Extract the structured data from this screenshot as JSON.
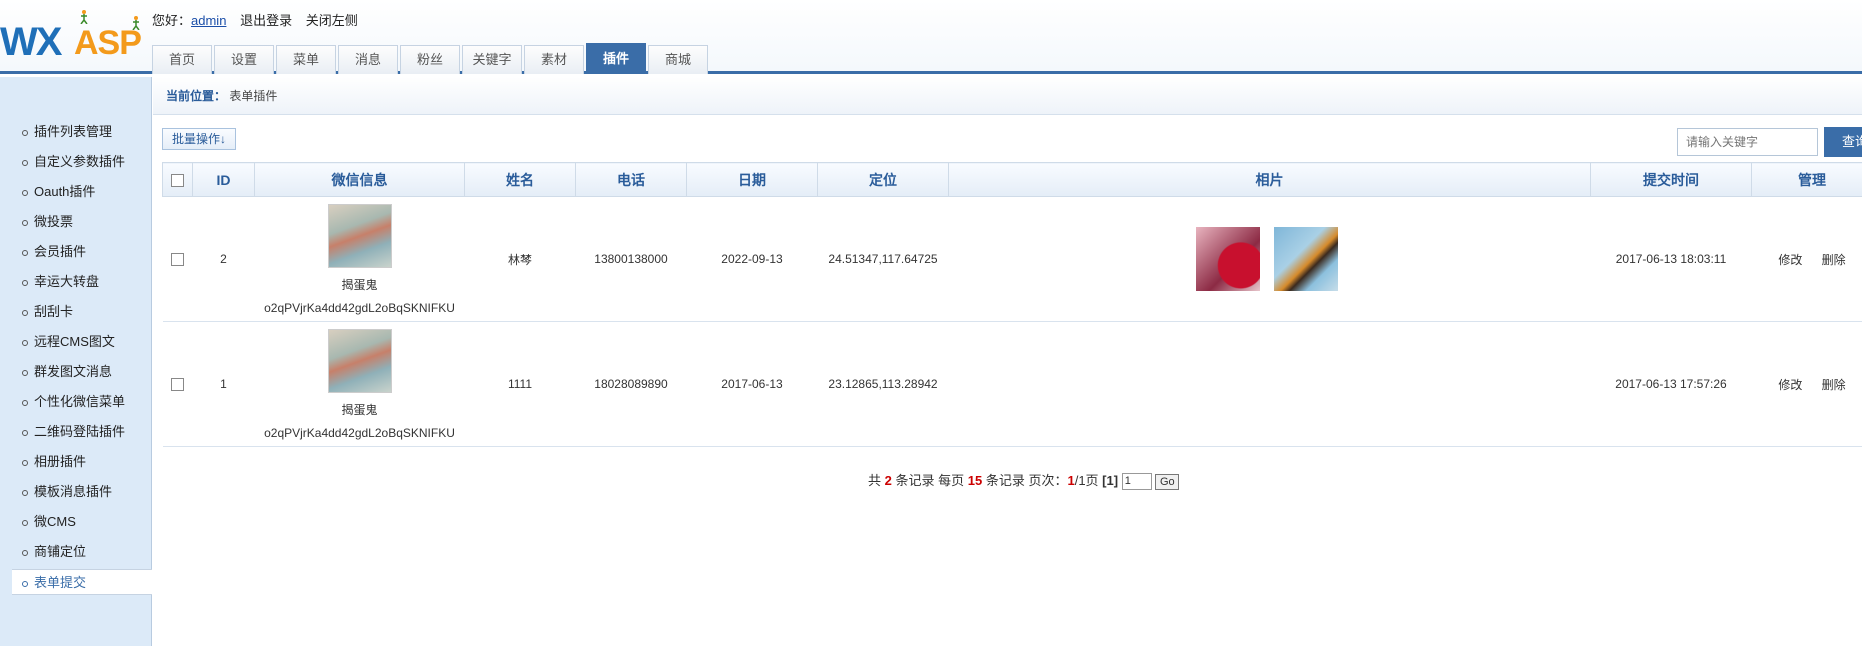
{
  "logo": {
    "text_left": "WX",
    "text_right": "ASP"
  },
  "userbar": {
    "greeting": "您好：",
    "username": "admin",
    "logout": "退出登录",
    "close_left": "关闭左侧"
  },
  "tabs": [
    {
      "label": "首页"
    },
    {
      "label": "设置"
    },
    {
      "label": "菜单"
    },
    {
      "label": "消息"
    },
    {
      "label": "粉丝"
    },
    {
      "label": "关键字"
    },
    {
      "label": "素材"
    },
    {
      "label": "插件",
      "active": true
    },
    {
      "label": "商城"
    }
  ],
  "sidebar": {
    "items": [
      {
        "label": "插件列表管理"
      },
      {
        "label": "自定义参数插件"
      },
      {
        "label": "Oauth插件"
      },
      {
        "label": "微投票"
      },
      {
        "label": "会员插件"
      },
      {
        "label": "幸运大转盘"
      },
      {
        "label": "刮刮卡"
      },
      {
        "label": "远程CMS图文"
      },
      {
        "label": "群发图文消息"
      },
      {
        "label": "个性化微信菜单"
      },
      {
        "label": "二维码登陆插件"
      },
      {
        "label": "相册插件"
      },
      {
        "label": "模板消息插件"
      },
      {
        "label": "微CMS"
      },
      {
        "label": "商铺定位"
      },
      {
        "label": "表单提交",
        "active": true
      }
    ]
  },
  "breadcrumb": {
    "label": "当前位置：",
    "current": "表单插件"
  },
  "toolbar": {
    "batch_label": "批量操作↓",
    "search_placeholder": "请输入关键字",
    "search_label": "查询"
  },
  "table": {
    "headers": [
      "ID",
      "微信信息",
      "姓名",
      "电话",
      "日期",
      "定位",
      "相片",
      "提交时间",
      "管理"
    ],
    "rows": [
      {
        "id": "2",
        "wx_name": "揭蛋鬼",
        "wx_id": "o2qPVjrKa4dd42gdL2oBqSKNIFKU",
        "name": "林棽",
        "phone": "13800138000",
        "date": "2022-09-13",
        "location": "24.51347,117.64725",
        "photos": 2,
        "submit_time": "2017-06-13 18:03:11",
        "edit": "修改",
        "delete": "删除"
      },
      {
        "id": "1",
        "wx_name": "揭蛋鬼",
        "wx_id": "o2qPVjrKa4dd42gdL2oBqSKNIFKU",
        "name": "1111",
        "phone": "18028089890",
        "date": "2017-06-13",
        "location": "23.12865,113.28942",
        "photos": 0,
        "submit_time": "2017-06-13 17:57:26",
        "edit": "修改",
        "delete": "删除"
      }
    ]
  },
  "pager": {
    "total_prefix": "共",
    "total": "2",
    "total_suffix": "条记录 每页",
    "per_page": "15",
    "per_page_suffix": "条记录 页次：",
    "current": "1",
    "pages": "/1页",
    "bracket": "[1]",
    "input_value": "1",
    "go": "Go"
  }
}
